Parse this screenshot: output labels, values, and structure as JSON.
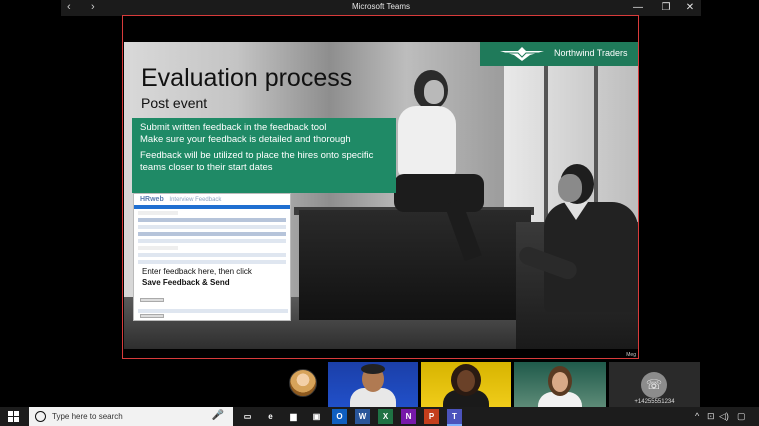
{
  "titlebar": {
    "title": "Microsoft Teams",
    "back_glyph": "‹",
    "forward_glyph": "›",
    "minimize_glyph": "—",
    "maximize_glyph": "❐",
    "close_glyph": "✕"
  },
  "slide": {
    "brand": "Northwind Traders",
    "title": "Evaluation process",
    "subtitle": "Post event",
    "bullets": [
      "Submit written feedback in the feedback tool",
      "Make sure your feedback is detailed and thorough",
      "Feedback will be utilized to place the hires onto specific teams closer to their start dates"
    ],
    "form": {
      "brand": "HRweb",
      "tab": "Interview Feedback",
      "prompt": "Enter feedback here, then click",
      "prompt_bold": "Save Feedback & Send"
    },
    "presenter_label": "Meg"
  },
  "participants": {
    "phone_glyph": "☏",
    "phone_number": "+14255551234"
  },
  "taskbar": {
    "search_placeholder": "Type here to search",
    "mic_glyph": "🎤",
    "apps": [
      {
        "name": "task-view",
        "glyph": "▭",
        "color": "#1c1c1c"
      },
      {
        "name": "edge",
        "glyph": "e",
        "color": "#1c1c1c"
      },
      {
        "name": "file-explorer",
        "glyph": "▆",
        "color": "#1c1c1c"
      },
      {
        "name": "store",
        "glyph": "▣",
        "color": "#1c1c1c"
      },
      {
        "name": "outlook",
        "glyph": "O",
        "color": "#0f5fbf"
      },
      {
        "name": "word",
        "glyph": "W",
        "color": "#2a5699"
      },
      {
        "name": "excel",
        "glyph": "X",
        "color": "#1f7244"
      },
      {
        "name": "onenote",
        "glyph": "N",
        "color": "#7719aa"
      },
      {
        "name": "powerpoint",
        "glyph": "P",
        "color": "#c43e1c"
      },
      {
        "name": "teams",
        "glyph": "T",
        "color": "#4b53bc"
      }
    ],
    "tray": {
      "chevron": "^",
      "network": "⊡",
      "volume": "◁)",
      "notifications": "▢"
    }
  },
  "colors": {
    "accent_green": "#1f8a66",
    "share_border": "#d83b3b",
    "taskbar": "#1c1c1c"
  }
}
